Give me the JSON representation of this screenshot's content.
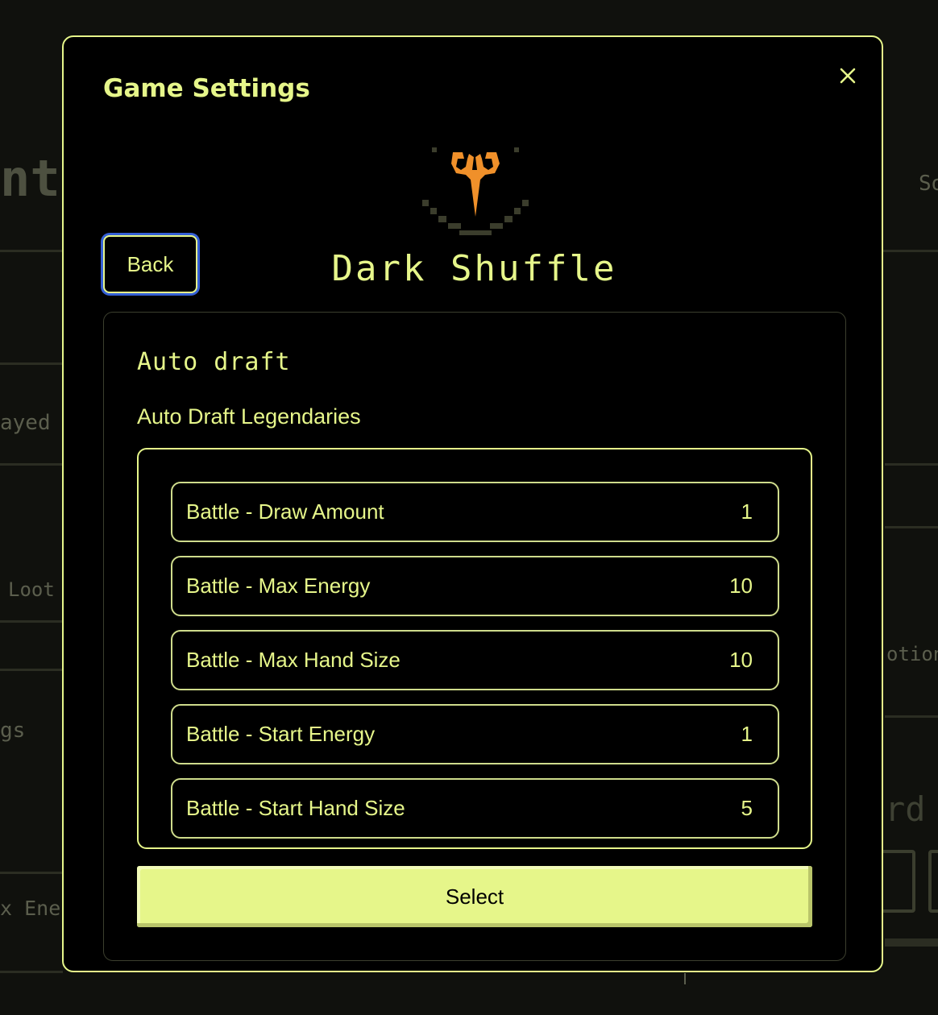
{
  "modal": {
    "title": "Game Settings",
    "close_icon": "close-icon",
    "back_label": "Back",
    "logo_icon": "horned-mask-logo",
    "game_name": "Dark Shuffle"
  },
  "panel": {
    "title": "Auto draft",
    "subtitle": "Auto Draft Legendaries",
    "settings": [
      {
        "label": "Battle - Draw Amount",
        "value": "1"
      },
      {
        "label": "Battle - Max Energy",
        "value": "10"
      },
      {
        "label": "Battle - Max Hand Size",
        "value": "10"
      },
      {
        "label": "Battle - Start Energy",
        "value": "1"
      },
      {
        "label": "Battle - Start Hand Size",
        "value": "5"
      }
    ],
    "select_label": "Select"
  },
  "background": {
    "fragments": [
      "nt",
      "So",
      "ayed",
      "Loot",
      "otion",
      "gs",
      "rd S",
      "x Energ"
    ]
  },
  "colors": {
    "accent": "#e6f68a",
    "background": "#000000",
    "focus_ring": "#3560d6",
    "logo_orange": "#f0902a"
  }
}
